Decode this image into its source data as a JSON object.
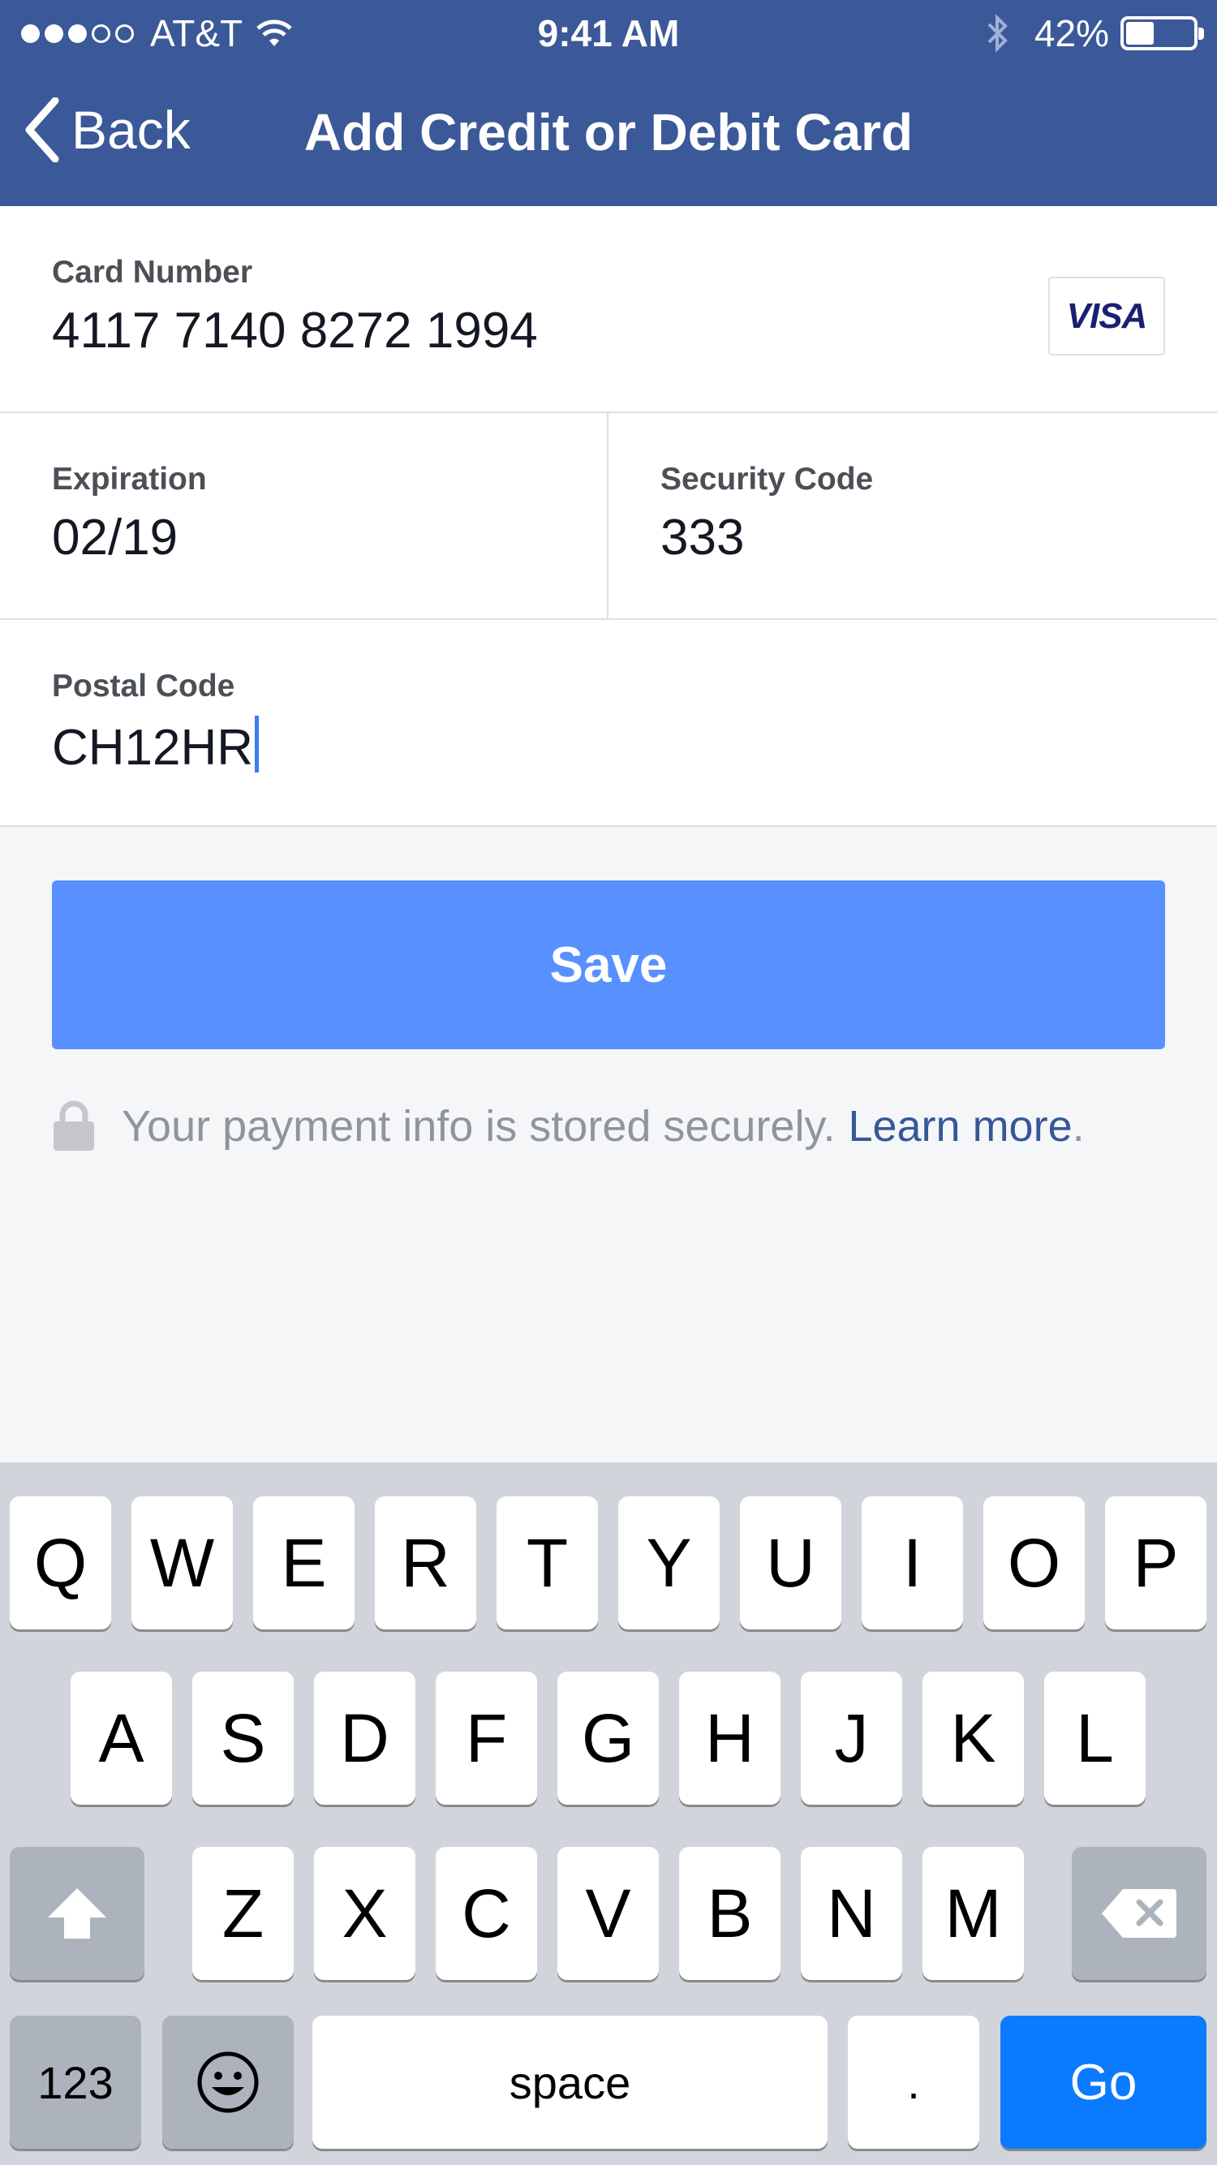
{
  "status_bar": {
    "carrier": "AT&T",
    "time": "9:41 AM",
    "battery": "42%",
    "battery_level": 0.42,
    "signal_bars_filled": 3,
    "signal_bars_total": 5
  },
  "nav": {
    "back_label": "Back",
    "title": "Add Credit or Debit Card"
  },
  "form": {
    "card_number_label": "Card Number",
    "card_number": "4117 7140 8272 1994",
    "card_brand": "VISA",
    "expiration_label": "Expiration",
    "expiration": "02/19",
    "security_code_label": "Security Code",
    "security_code": "333",
    "postal_code_label": "Postal Code",
    "postal_code": "CH12HR"
  },
  "save_label": "Save",
  "secure_note": {
    "text": "Your payment info is stored securely.",
    "link": "Learn more",
    "period": "."
  },
  "keyboard": {
    "row1": [
      "Q",
      "W",
      "E",
      "R",
      "T",
      "Y",
      "U",
      "I",
      "O",
      "P"
    ],
    "row2": [
      "A",
      "S",
      "D",
      "F",
      "G",
      "H",
      "J",
      "K",
      "L"
    ],
    "row3": [
      "Z",
      "X",
      "C",
      "V",
      "B",
      "N",
      "M"
    ],
    "numbers": "123",
    "space": "space",
    "period": ".",
    "go": "Go"
  },
  "colors": {
    "header": "#3b5998",
    "save_button": "#5890ff",
    "link": "#365899",
    "go_key": "#0a7aff"
  }
}
